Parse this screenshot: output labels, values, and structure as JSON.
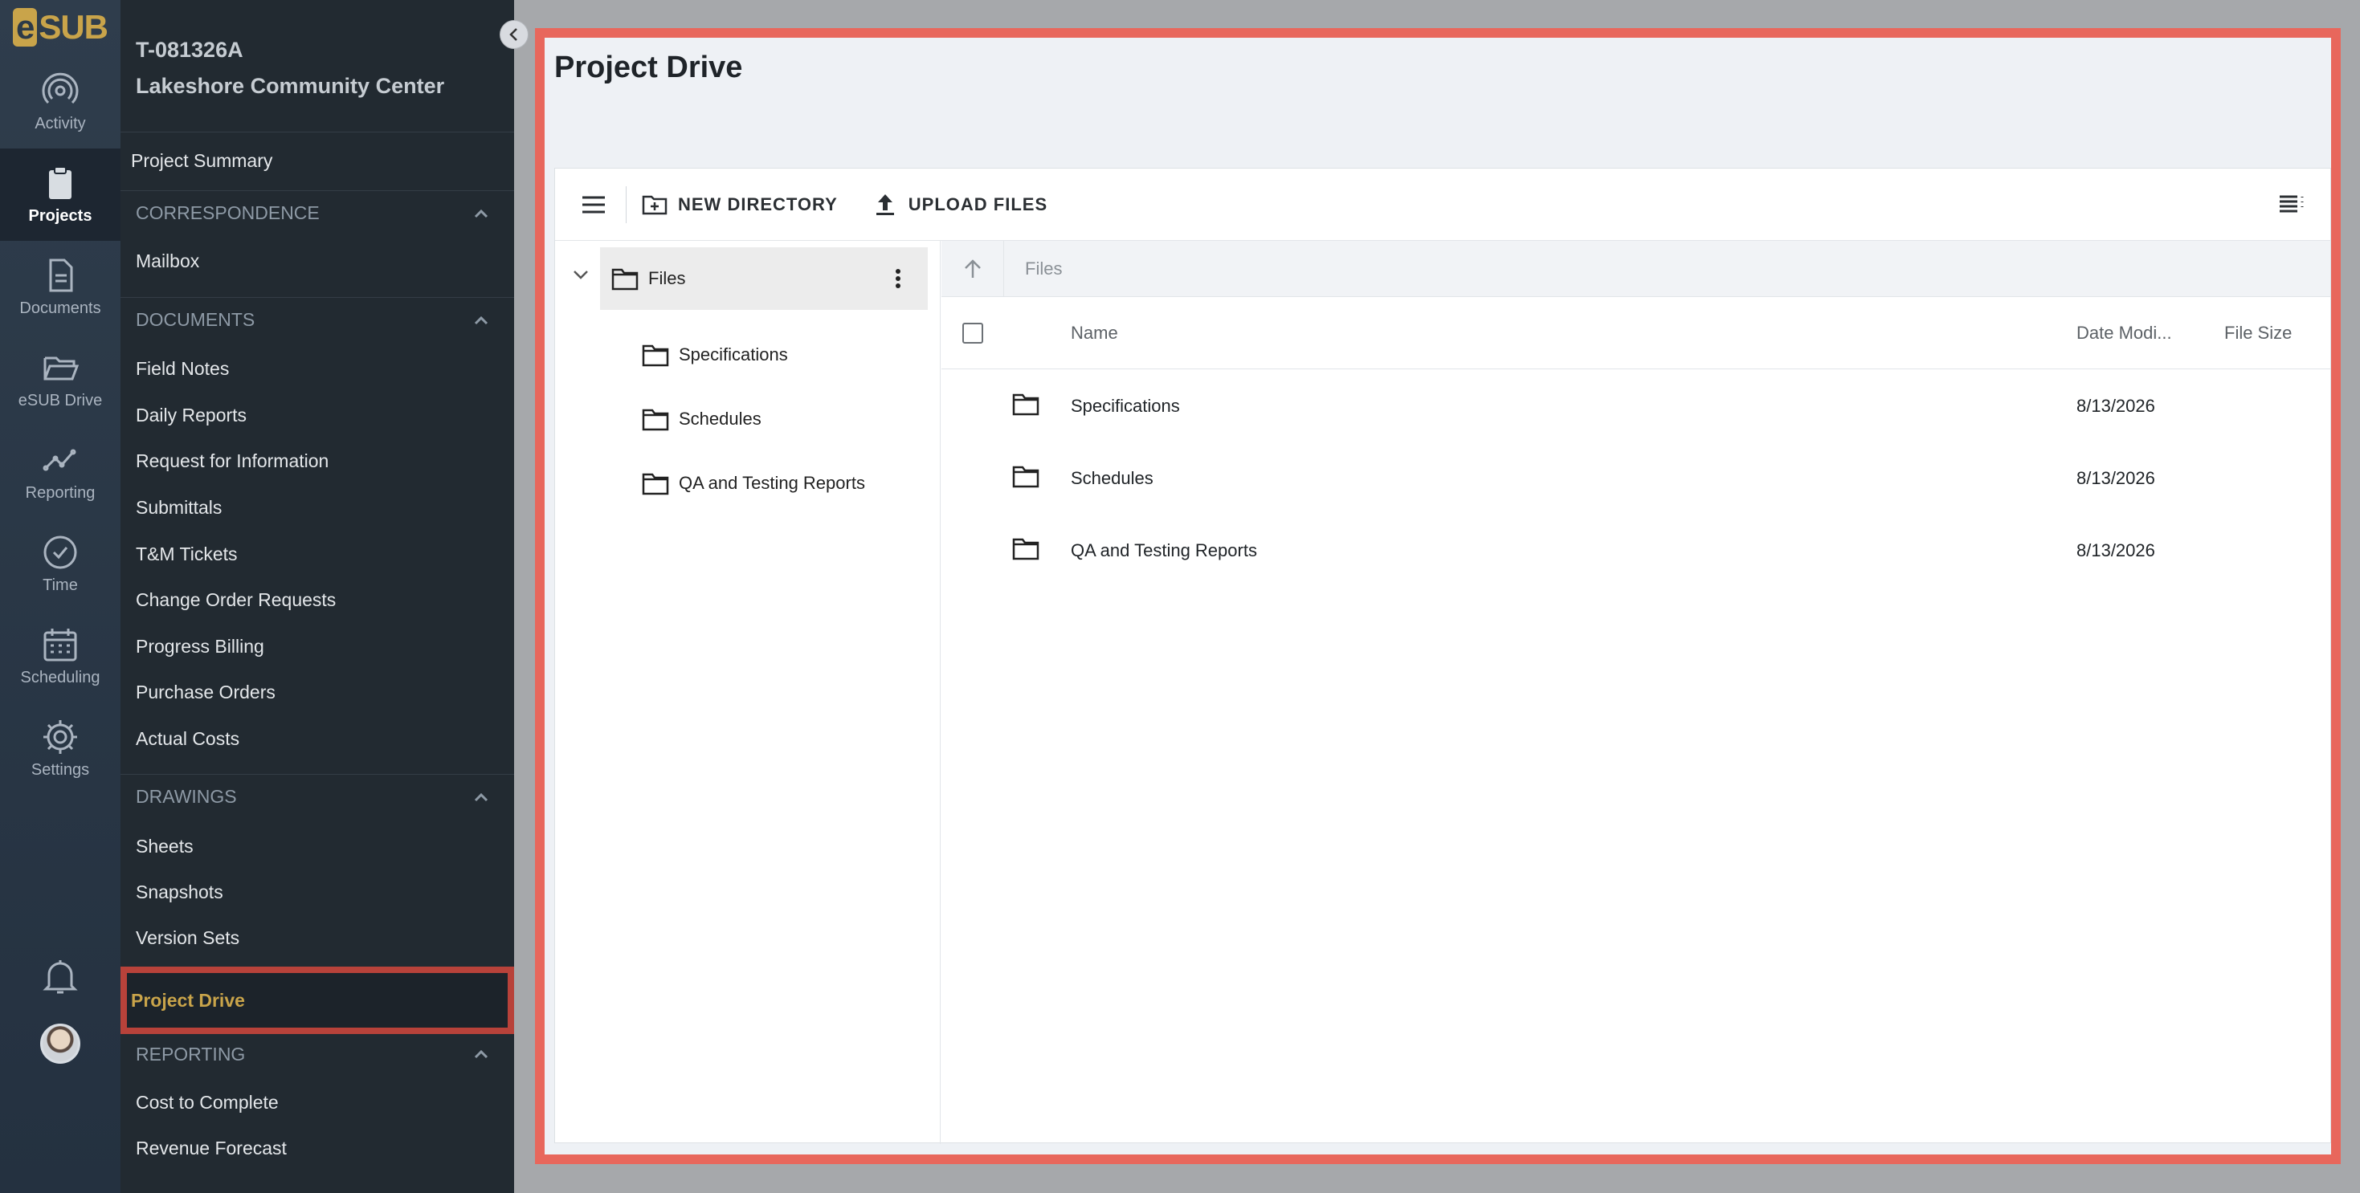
{
  "brand": {
    "logo_text": "SUB",
    "logo_letter": "e"
  },
  "rail": {
    "items": [
      {
        "label": "Activity",
        "icon": "activity-icon"
      },
      {
        "label": "Projects",
        "icon": "clipboard-icon",
        "active": true
      },
      {
        "label": "Documents",
        "icon": "document-icon"
      },
      {
        "label": "eSUB Drive",
        "icon": "folder-open-icon"
      },
      {
        "label": "Reporting",
        "icon": "chart-icon"
      },
      {
        "label": "Time",
        "icon": "clock-icon"
      },
      {
        "label": "Scheduling",
        "icon": "calendar-icon"
      },
      {
        "label": "Settings",
        "icon": "gear-icon"
      }
    ]
  },
  "project": {
    "number": "T-081326A",
    "name": "Lakeshore Community Center"
  },
  "nav": {
    "summary": "Project Summary",
    "sections": {
      "correspondence": {
        "title": "CORRESPONDENCE",
        "items": [
          "Mailbox"
        ]
      },
      "documents": {
        "title": "DOCUMENTS",
        "items": [
          "Field Notes",
          "Daily Reports",
          "Request for Information",
          "Submittals",
          "T&M Tickets",
          "Change Order Requests",
          "Progress Billing",
          "Purchase Orders",
          "Actual Costs"
        ]
      },
      "drawings": {
        "title": "DRAWINGS",
        "items": [
          "Sheets",
          "Snapshots",
          "Version Sets"
        ]
      },
      "reporting": {
        "title": "REPORTING",
        "items": [
          "Cost to Complete",
          "Revenue Forecast"
        ]
      }
    },
    "active": "Project Drive"
  },
  "page": {
    "title": "Project Drive"
  },
  "toolbar": {
    "new_directory": "NEW DIRECTORY",
    "upload_files": "UPLOAD FILES"
  },
  "tree": {
    "root": "Files",
    "children": [
      "Specifications",
      "Schedules",
      "QA and Testing Reports"
    ]
  },
  "breadcrumb": "Files",
  "columns": {
    "name": "Name",
    "date": "Date Modi...",
    "size": "File Size"
  },
  "rows": [
    {
      "name": "Specifications",
      "date": "8/13/2026"
    },
    {
      "name": "Schedules",
      "date": "8/13/2026"
    },
    {
      "name": "QA and Testing Reports",
      "date": "8/13/2026"
    }
  ],
  "colors": {
    "accent": "#c9a44a",
    "highlight": "#e8675c",
    "nav_bg": "#222a31"
  }
}
